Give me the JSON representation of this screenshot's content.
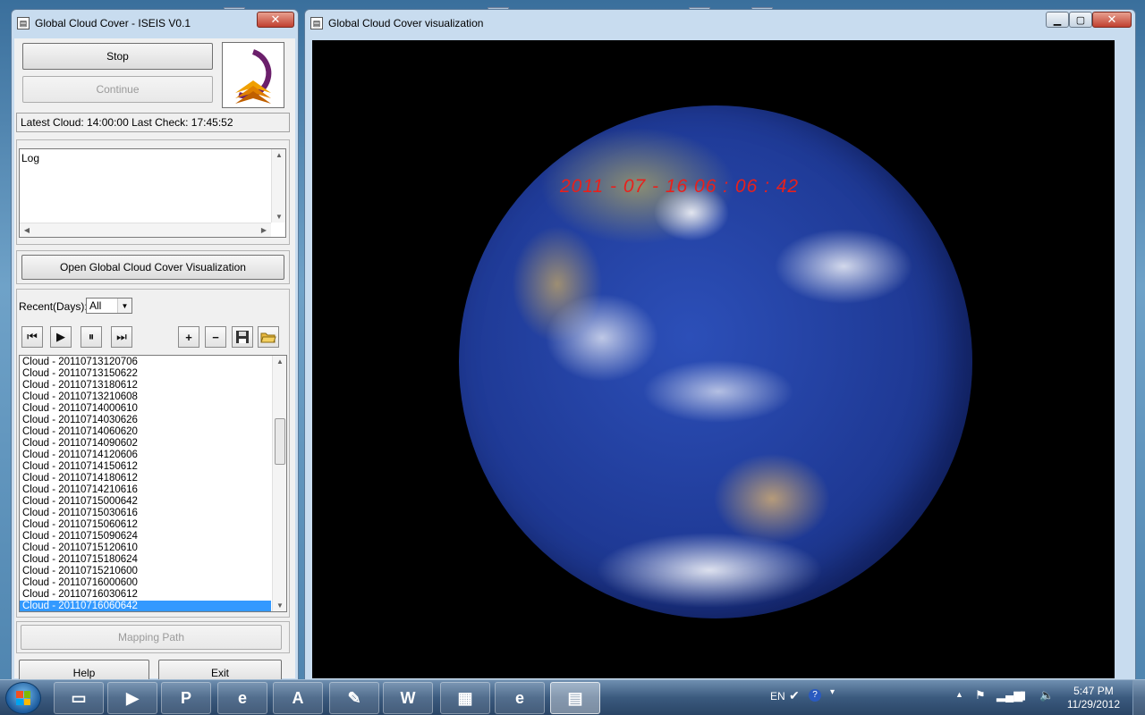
{
  "left_window": {
    "title": "Global Cloud Cover - ISEIS V0.1",
    "close_glyph": "✕",
    "stop_label": "Stop",
    "continue_label": "Continue",
    "status": "Latest Cloud: 14:00:00   Last Check: 17:45:52",
    "log_text": "Log",
    "open_viz_label": "Open Global Cloud Cover Visualization",
    "recent_label": "Recent(Days):",
    "recent_value": "All",
    "toolbar": {
      "first_glyph": "⏮",
      "play_glyph": "▶",
      "pause_glyph": "⏸",
      "last_glyph": "⏭",
      "add_glyph": "+",
      "remove_glyph": "−",
      "save_icon": "save-icon",
      "open_icon": "folder-open-icon"
    },
    "list_items": [
      "Cloud - 20110713120706",
      "Cloud - 20110713150622",
      "Cloud - 20110713180612",
      "Cloud - 20110713210608",
      "Cloud - 20110714000610",
      "Cloud - 20110714030626",
      "Cloud - 20110714060620",
      "Cloud - 20110714090602",
      "Cloud - 20110714120606",
      "Cloud - 20110714150612",
      "Cloud - 20110714180612",
      "Cloud - 20110714210616",
      "Cloud - 20110715000642",
      "Cloud - 20110715030616",
      "Cloud - 20110715060612",
      "Cloud - 20110715090624",
      "Cloud - 20110715120610",
      "Cloud - 20110715180624",
      "Cloud - 20110715210600",
      "Cloud - 20110716000600",
      "Cloud - 20110716030612",
      "Cloud - 20110716060642"
    ],
    "selected_index": 21,
    "mapping_path_label": "Mapping Path",
    "help_label": "Help",
    "exit_label": "Exit"
  },
  "right_window": {
    "title": "Global Cloud Cover visualization",
    "timestamp": "2011 - 07 - 16  06 : 06 : 42",
    "min_glyph": "▁",
    "max_glyph": "▢",
    "close_glyph": "✕"
  },
  "taskbar": {
    "lang": "EN",
    "time": "5:47 PM",
    "date": "11/29/2012",
    "apps": [
      {
        "name": "explorer",
        "glyph": "▭"
      },
      {
        "name": "media-player",
        "glyph": "▶"
      },
      {
        "name": "powerpoint",
        "glyph": "P"
      },
      {
        "name": "internet-explorer",
        "glyph": "e"
      },
      {
        "name": "acrobat",
        "glyph": "A"
      },
      {
        "name": "quill",
        "glyph": "✎"
      },
      {
        "name": "word",
        "glyph": "W"
      },
      {
        "name": "control-panel",
        "glyph": "▦"
      },
      {
        "name": "internet-explorer-2",
        "glyph": "e"
      },
      {
        "name": "cloud-app",
        "glyph": "▤"
      }
    ]
  },
  "colors": {
    "timestamp": "#e8201c",
    "selection": "#3399ff"
  }
}
